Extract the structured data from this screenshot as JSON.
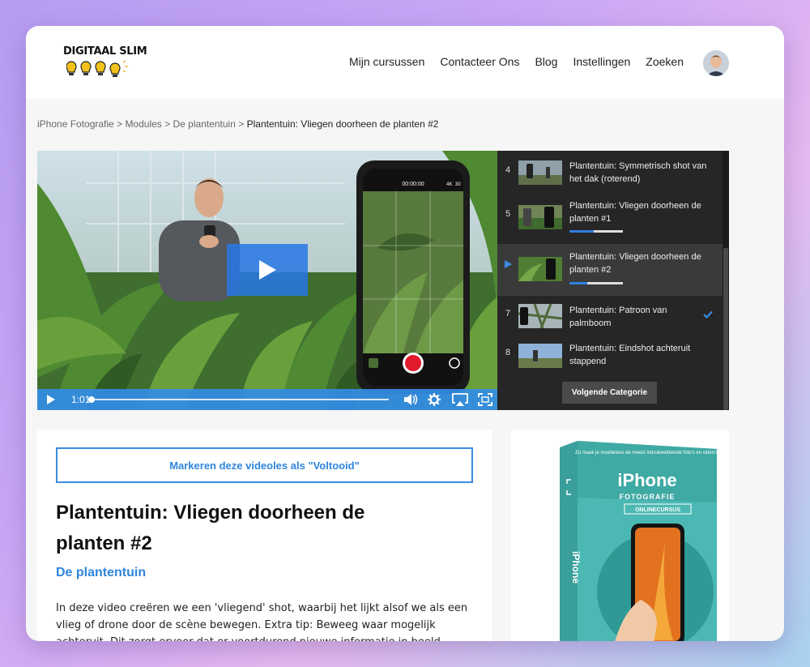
{
  "brand": {
    "logo_text": "DIGITAAL SLIM"
  },
  "nav": {
    "items": [
      "Mijn cursussen",
      "Contacteer Ons",
      "Blog",
      "Instellingen",
      "Zoeken"
    ]
  },
  "breadcrumb": {
    "items": [
      "iPhone Fotografie",
      "Modules",
      "De plantentuin"
    ],
    "separator": ">",
    "current": "Plantentuin: Vliegen doorheen de planten #2"
  },
  "player": {
    "time": "1:01",
    "phone_timer": "00:00:00",
    "phone_res": "4K",
    "phone_fps": "30",
    "progress": 0.0
  },
  "playlist": {
    "items": [
      {
        "num": "4",
        "title": "Plantentuin: Symmetrisch shot van het dak (roterend)",
        "progress": null,
        "active": false,
        "done": false
      },
      {
        "num": "5",
        "title": "Plantentuin: Vliegen doorheen de planten #1",
        "progress": 0.45,
        "active": false,
        "done": false
      },
      {
        "num": "",
        "title": "Plantentuin: Vliegen doorheen de planten #2",
        "progress": 0.33,
        "active": true,
        "done": false
      },
      {
        "num": "7",
        "title": "Plantentuin: Patroon van palmboom",
        "progress": null,
        "active": false,
        "done": true
      },
      {
        "num": "8",
        "title": "Plantentuin: Eindshot achteruit stappend",
        "progress": null,
        "active": false,
        "done": false
      }
    ],
    "next_label": "Volgende Categorie"
  },
  "lesson": {
    "mark_label": "Markeren deze videoles als \"Voltooid\"",
    "title": "Plantentuin: Vliegen doorheen de planten #2",
    "category": "De plantentuin",
    "description": "In deze video creëren we een 'vliegend' shot, waarbij het lijkt alsof we als een vlieg of drone door de scène bewegen. Extra tip: Beweeg waar mogelijk achteruit. Dit zorgt ervoor dat er voortdurend nieuwe informatie in beeld komt, wat een dynamischer"
  },
  "promo": {
    "tagline": "Zo maak je moeiteloos de meest indrukwekkende foto's en video's!",
    "brand": "iPhone",
    "sub": "FOTOGRAFIE",
    "badge": "ONLINECURSUS",
    "spine": "iPhone"
  },
  "colors": {
    "accent": "#2f86dd",
    "dark_panel": "#262626",
    "check": "#3b8ce0"
  },
  "icons": [
    "play-icon",
    "volume-icon",
    "settings-icon",
    "airplay-icon",
    "fullscreen-icon",
    "check-icon",
    "play-indicator-icon",
    "lightbulb-icon"
  ]
}
